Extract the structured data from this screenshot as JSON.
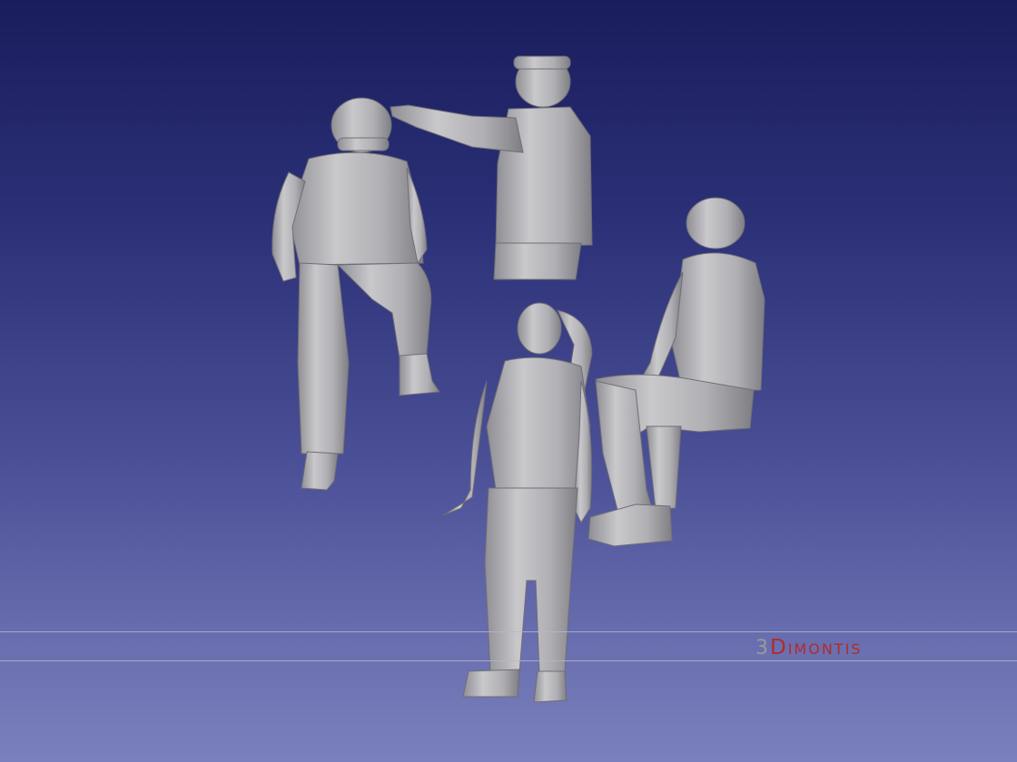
{
  "watermark": {
    "prefix": "3",
    "name": "Dimontis"
  },
  "colors": {
    "background_top": "#1a1d5c",
    "background_bottom": "#7a80bc",
    "model_gray": "#b8b8b8",
    "logo_red": "#b22a2a",
    "logo_gray": "#9a9a9a"
  }
}
